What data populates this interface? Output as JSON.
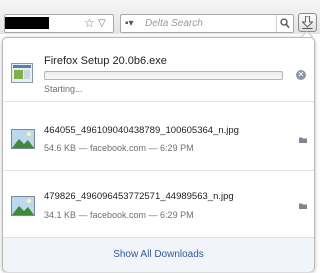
{
  "toolbar": {
    "search_placeholder": "Delta Search"
  },
  "downloads": [
    {
      "name": "Firefox Setup 20.0b6.exe",
      "status": "Starting...",
      "progress": 0,
      "icon": "exe-file-icon",
      "action_icon": "cancel-icon"
    },
    {
      "name": "464055_496109040438789_100605364_n.jpg",
      "status": "54.6 KB — facebook.com — 6:29 PM",
      "icon": "image-file-icon",
      "action_icon": "folder-icon"
    },
    {
      "name": "479826_496096453772571_44989563_n.jpg",
      "status": "34.1 KB — facebook.com — 6:29 PM",
      "icon": "image-file-icon",
      "action_icon": "folder-icon"
    }
  ],
  "footer": {
    "show_all_label": "Show All Downloads"
  },
  "colors": {
    "progress_fill": "#66a3e0",
    "link": "#2e5a9c"
  }
}
